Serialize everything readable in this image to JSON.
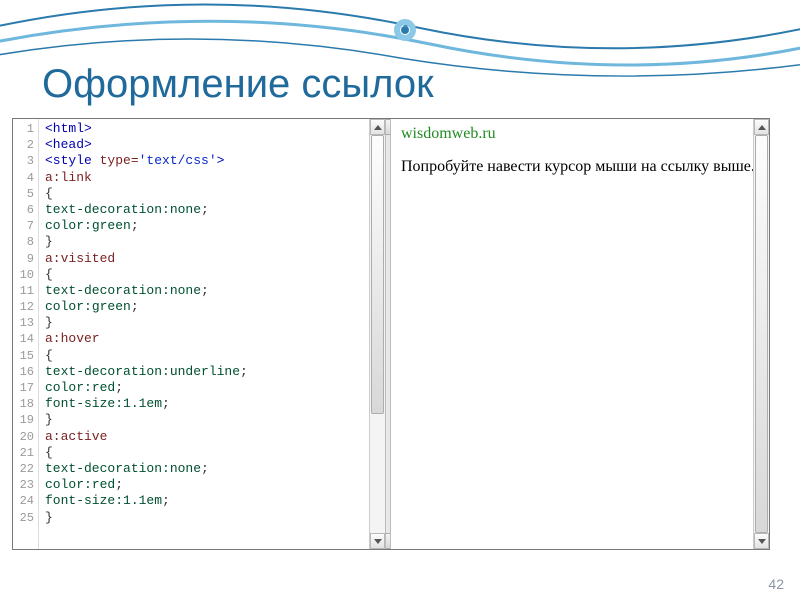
{
  "slide": {
    "title": "Оформление ссылок",
    "page_number": "42"
  },
  "code": {
    "lines": [
      [
        {
          "t": "<html>",
          "c": "tag"
        }
      ],
      [
        {
          "t": "<head>",
          "c": "tag"
        }
      ],
      [
        {
          "t": "<style ",
          "c": "tag"
        },
        {
          "t": "type=",
          "c": "attr"
        },
        {
          "t": "'text/css'",
          "c": "str"
        },
        {
          "t": ">",
          "c": "tag"
        }
      ],
      [
        {
          "t": "a:link",
          "c": "sel"
        }
      ],
      [
        {
          "t": "{",
          "c": "punct"
        }
      ],
      [
        {
          "t": "text-decoration:",
          "c": "prop"
        },
        {
          "t": "none",
          "c": "val"
        },
        {
          "t": ";",
          "c": "punct"
        }
      ],
      [
        {
          "t": "color:",
          "c": "prop"
        },
        {
          "t": "green",
          "c": "val"
        },
        {
          "t": ";",
          "c": "punct"
        }
      ],
      [
        {
          "t": "}",
          "c": "punct"
        }
      ],
      [
        {
          "t": "a:visited",
          "c": "sel"
        }
      ],
      [
        {
          "t": "{",
          "c": "punct"
        }
      ],
      [
        {
          "t": "text-decoration:",
          "c": "prop"
        },
        {
          "t": "none",
          "c": "val"
        },
        {
          "t": ";",
          "c": "punct"
        }
      ],
      [
        {
          "t": "color:",
          "c": "prop"
        },
        {
          "t": "green",
          "c": "val"
        },
        {
          "t": ";",
          "c": "punct"
        }
      ],
      [
        {
          "t": "}",
          "c": "punct"
        }
      ],
      [
        {
          "t": "a:hover",
          "c": "sel"
        }
      ],
      [
        {
          "t": "{",
          "c": "punct"
        }
      ],
      [
        {
          "t": "text-decoration:",
          "c": "prop"
        },
        {
          "t": "underline",
          "c": "val"
        },
        {
          "t": ";",
          "c": "punct"
        }
      ],
      [
        {
          "t": "color:",
          "c": "prop"
        },
        {
          "t": "red",
          "c": "val"
        },
        {
          "t": ";",
          "c": "punct"
        }
      ],
      [
        {
          "t": "font-size:",
          "c": "prop"
        },
        {
          "t": "1.1em",
          "c": "val"
        },
        {
          "t": ";",
          "c": "punct"
        }
      ],
      [
        {
          "t": "}",
          "c": "punct"
        }
      ],
      [
        {
          "t": "a:active",
          "c": "sel"
        }
      ],
      [
        {
          "t": "{",
          "c": "punct"
        }
      ],
      [
        {
          "t": "text-decoration:",
          "c": "prop"
        },
        {
          "t": "none",
          "c": "val"
        },
        {
          "t": ";",
          "c": "punct"
        }
      ],
      [
        {
          "t": "color:",
          "c": "prop"
        },
        {
          "t": "red",
          "c": "val"
        },
        {
          "t": ";",
          "c": "punct"
        }
      ],
      [
        {
          "t": "font-size:",
          "c": "prop"
        },
        {
          "t": "1.1em",
          "c": "val"
        },
        {
          "t": ";",
          "c": "punct"
        }
      ],
      [
        {
          "t": "}",
          "c": "punct"
        }
      ]
    ]
  },
  "preview": {
    "link_text": "wisdomweb.ru",
    "body_text": "Попробуйте навести курсор мыши на ссылку выше."
  },
  "scroll": {
    "code_thumb": {
      "top_pct": 0,
      "height_pct": 70
    },
    "preview_thumb": {
      "top_pct": 0,
      "height_pct": 100
    }
  }
}
